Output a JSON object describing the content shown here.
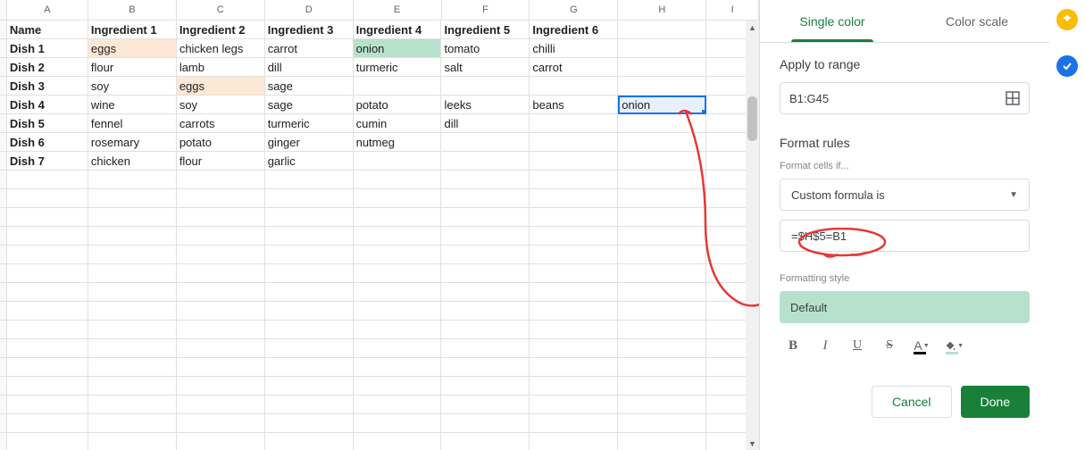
{
  "columns": [
    "A",
    "B",
    "C",
    "D",
    "E",
    "F",
    "G",
    "H",
    "I"
  ],
  "headers": {
    "A": "Name",
    "B": "Ingredient 1",
    "C": "Ingredient 2",
    "D": "Ingredient 3",
    "E": "Ingredient 4",
    "F": "Ingredient 5",
    "G": "Ingredient 6"
  },
  "rows": [
    {
      "A": "Dish 1",
      "B": "eggs",
      "C": "chicken legs",
      "D": "carrot",
      "E": "onion",
      "F": "tomato",
      "G": "chilli"
    },
    {
      "A": "Dish 2",
      "B": "flour",
      "C": "lamb",
      "D": "dill",
      "E": "turmeric",
      "F": "salt",
      "G": "carrot"
    },
    {
      "A": "Dish 3",
      "B": "soy",
      "C": "eggs",
      "D": "sage",
      "E": "",
      "F": "",
      "G": ""
    },
    {
      "A": "Dish 4",
      "B": "wine",
      "C": "soy",
      "D": "sage",
      "E": "potato",
      "F": "leeks",
      "G": "beans",
      "H": "onion"
    },
    {
      "A": "Dish 5",
      "B": "fennel",
      "C": "carrots",
      "D": "turmeric",
      "E": "cumin",
      "F": "dill",
      "G": ""
    },
    {
      "A": "Dish 6",
      "B": "rosemary",
      "C": "potato",
      "D": "ginger",
      "E": "nutmeg",
      "F": "",
      "G": ""
    },
    {
      "A": "Dish 7",
      "B": "chicken",
      "C": "flour",
      "D": "garlic",
      "E": "",
      "F": "",
      "G": ""
    }
  ],
  "highlights": {
    "orange": [
      "r1.B",
      "r3.C"
    ],
    "green": [
      "r1.E"
    ]
  },
  "selected_cell": "H5",
  "selected_value": "onion",
  "sidebar": {
    "tab_single": "Single color",
    "tab_scale": "Color scale",
    "apply_label": "Apply to range",
    "range_value": "B1:G45",
    "rules_label": "Format rules",
    "cells_if_label": "Format cells if...",
    "condition": "Custom formula is",
    "formula": "=$H$5=B1",
    "style_label": "Formatting style",
    "default_label": "Default",
    "cancel": "Cancel",
    "done": "Done"
  }
}
